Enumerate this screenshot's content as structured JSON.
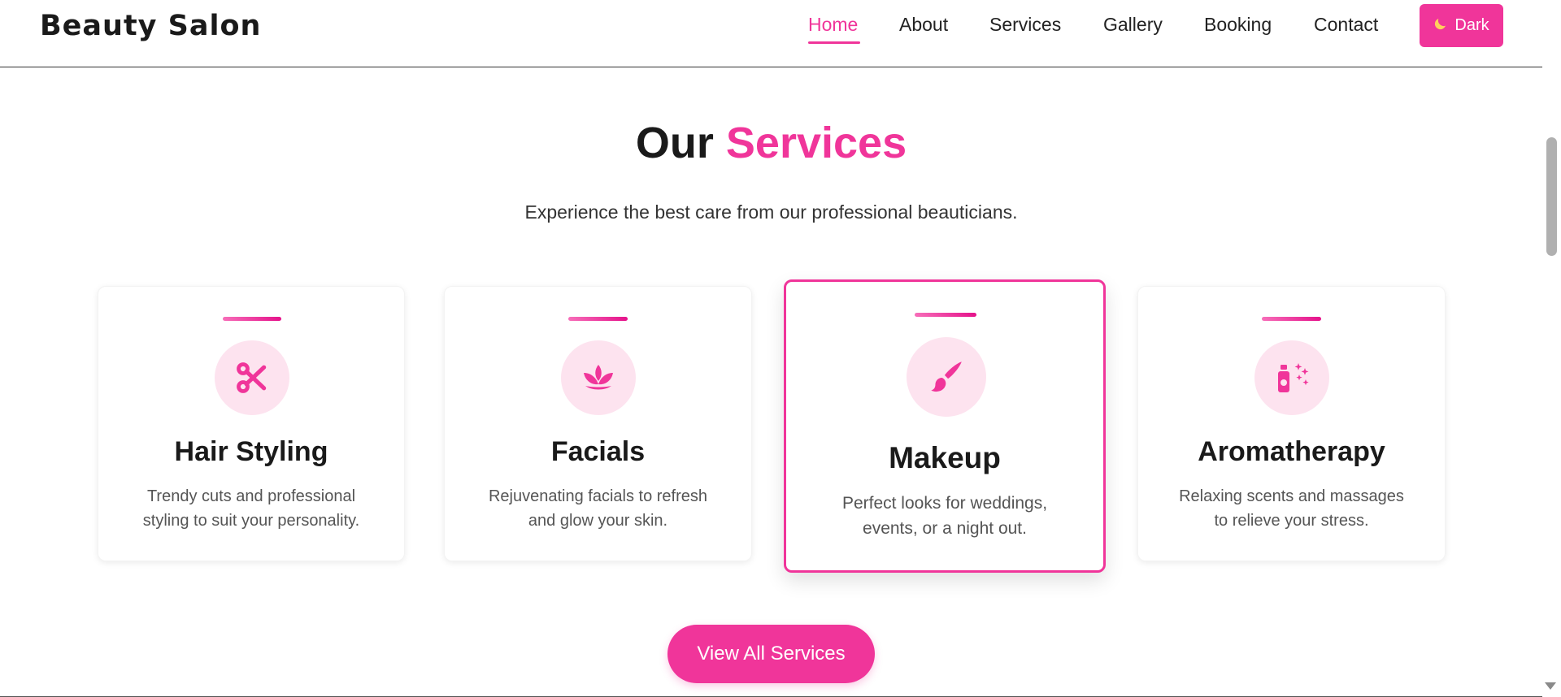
{
  "header": {
    "logo": "Beauty Salon",
    "nav": [
      {
        "label": "Home",
        "active": true
      },
      {
        "label": "About"
      },
      {
        "label": "Services"
      },
      {
        "label": "Gallery"
      },
      {
        "label": "Booking"
      },
      {
        "label": "Contact"
      }
    ],
    "theme_toggle": {
      "label": "Dark",
      "icon": "moon-icon"
    }
  },
  "services": {
    "title_part1": "Our",
    "title_part2": "Services",
    "subtitle": "Experience the best care from our professional beauticians.",
    "cards": [
      {
        "title": "Hair Styling",
        "desc_line1": "Trendy cuts and professional",
        "desc_line2": "styling to suit your personality.",
        "icon": "scissors-icon"
      },
      {
        "title": "Facials",
        "desc_line1": "Rejuvenating facials to refresh",
        "desc_line2": "and glow your skin.",
        "icon": "lotus-icon"
      },
      {
        "title": "Makeup",
        "desc_line1": "Perfect looks for weddings,",
        "desc_line2": "events, or a night out.",
        "icon": "makeup-brush-icon",
        "highlighted": true
      },
      {
        "title": "Aromatherapy",
        "desc_line1": "Relaxing scents and massages",
        "desc_line2": "to relieve your stress.",
        "icon": "spray-bottle-icon"
      }
    ],
    "cta_label": "View All Services"
  },
  "colors": {
    "accent": "#f0359a",
    "icon_bg": "#fde3ef",
    "text": "#1a1a1a"
  }
}
